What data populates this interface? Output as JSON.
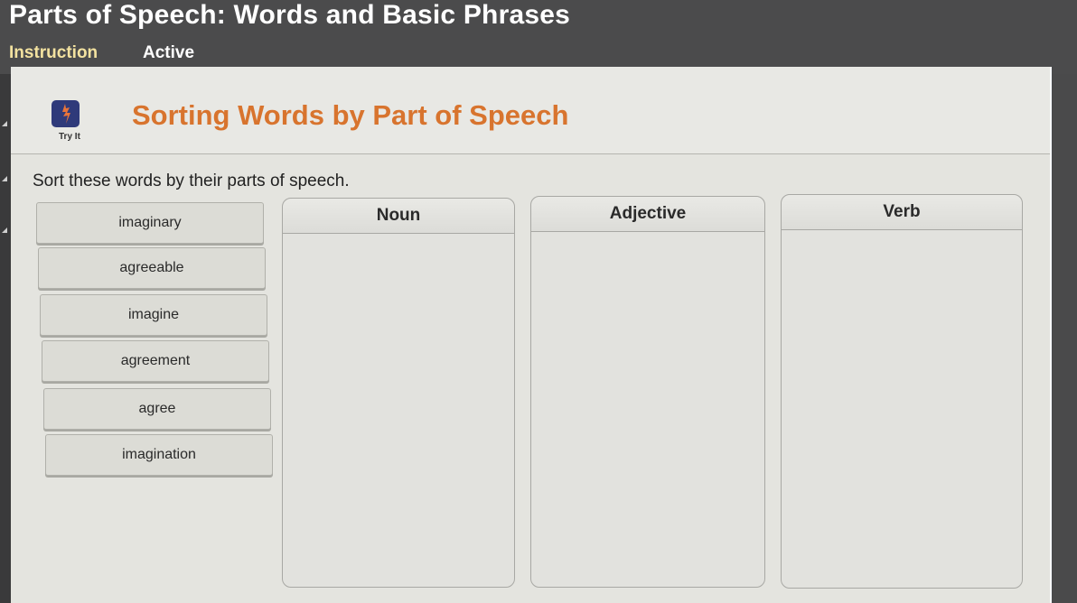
{
  "app": {
    "title": "Parts of Speech: Words and Basic Phrases",
    "tabs": [
      {
        "label": "Instruction",
        "color": "#f3e2a0"
      },
      {
        "label": "Active",
        "color": "#ffffff"
      }
    ]
  },
  "activity": {
    "icon": "lightning-bolt-icon",
    "icon_label": "Try It",
    "title": "Sorting Words by Part of Speech",
    "title_color": "#d8742e",
    "instruction": "Sort these words by their parts of speech."
  },
  "word_bank": [
    {
      "word": "imaginary"
    },
    {
      "word": "agreeable"
    },
    {
      "word": "imagine"
    },
    {
      "word": "agreement"
    },
    {
      "word": "agree"
    },
    {
      "word": "imagination"
    }
  ],
  "bins": [
    {
      "label": "Noun",
      "items": []
    },
    {
      "label": "Adjective",
      "items": []
    },
    {
      "label": "Verb",
      "items": []
    }
  ]
}
